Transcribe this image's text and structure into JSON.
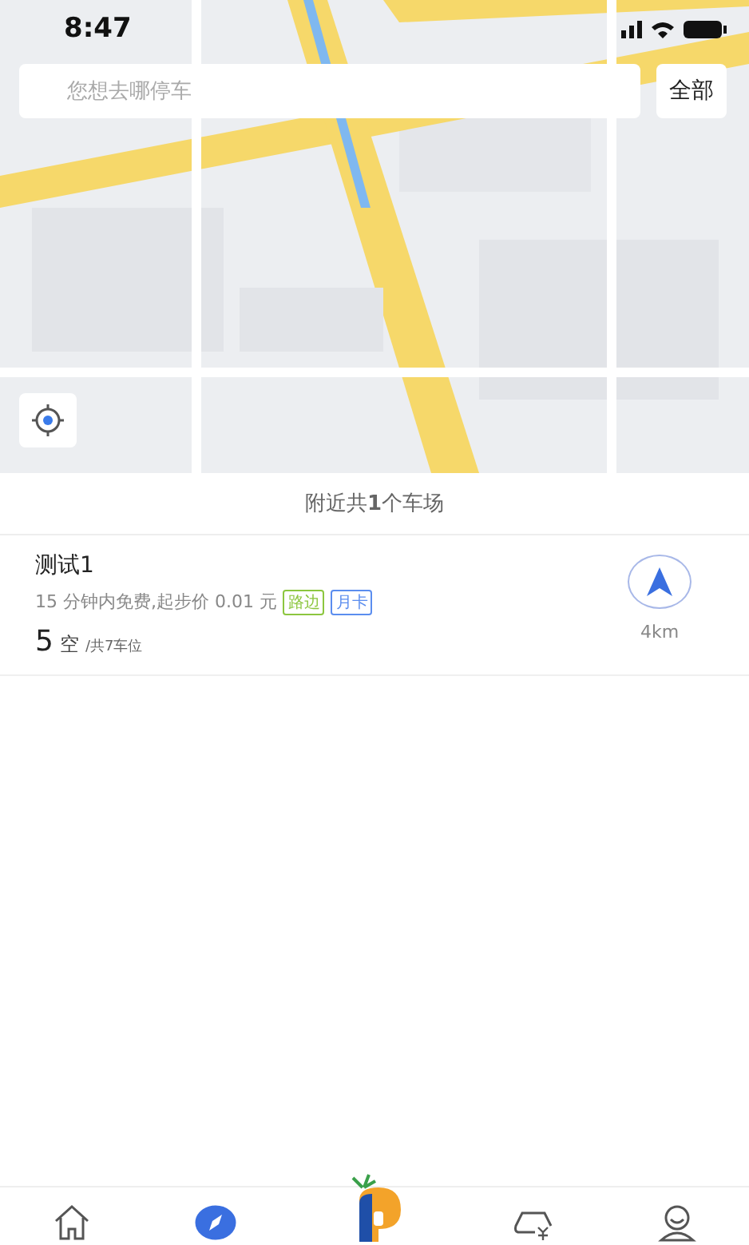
{
  "status_bar": {
    "time": "8:47"
  },
  "search": {
    "placeholder": "您想去哪停车",
    "filter_button": "全部"
  },
  "summary": "附近共**1**个车场",
  "lots": [
    {
      "name": "测试1",
      "price": "15 分钟内免费,起步价 0.01 元",
      "tags": [
        {
          "label": "路边",
          "color": "#8cc63f"
        },
        {
          "label": "月卡",
          "color": "#5b8def"
        }
      ],
      "free": "5",
      "free_label": "空",
      "total": "/共7车位",
      "distance": "4km"
    }
  ],
  "tabs": [
    {
      "kind": "home",
      "selected": false
    },
    {
      "kind": "compass",
      "selected": true
    },
    {
      "kind": "logo",
      "selected": false
    },
    {
      "kind": "wallet",
      "selected": false
    },
    {
      "kind": "profile",
      "selected": false
    }
  ]
}
